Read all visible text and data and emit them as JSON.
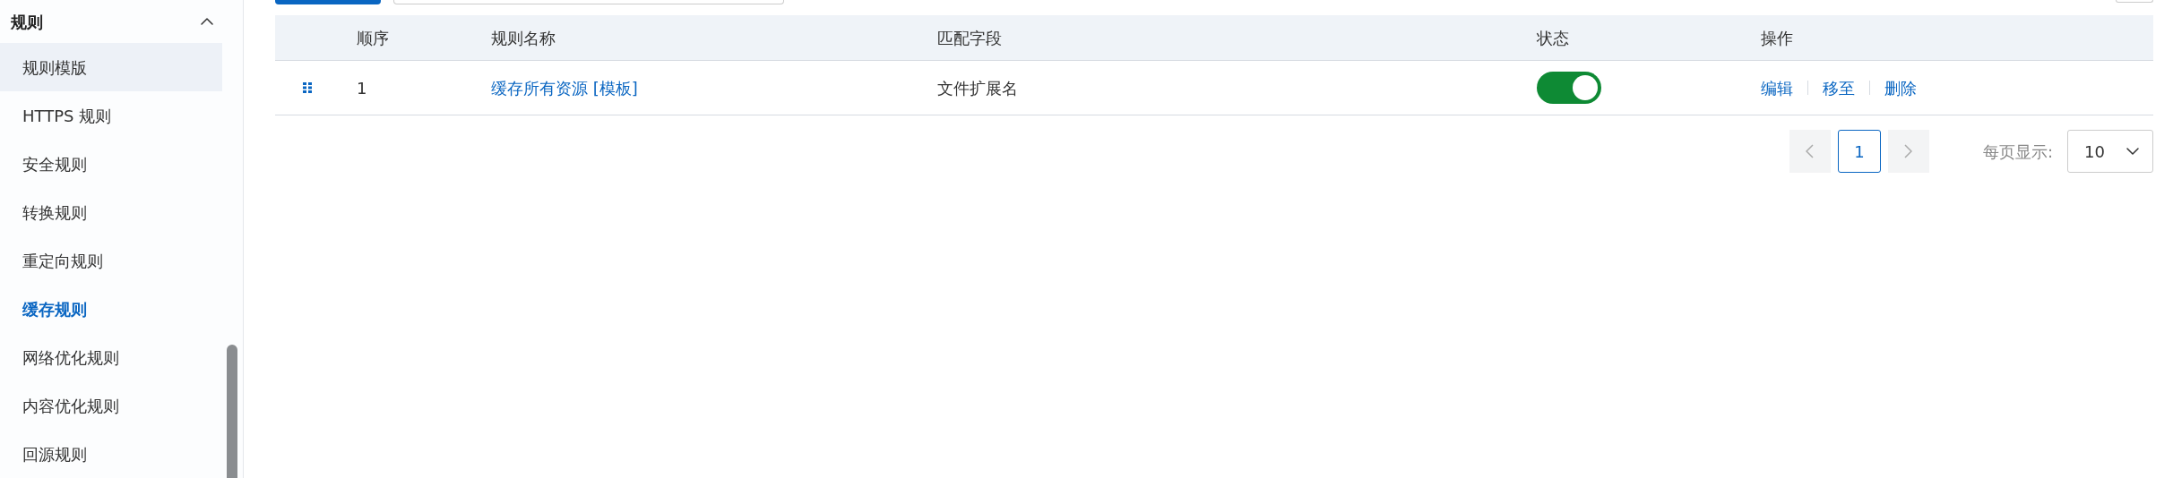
{
  "sidebar": {
    "group": {
      "label": "规则",
      "expanded": true
    },
    "items": [
      {
        "label": "规则模版",
        "selected": false,
        "hovered": true
      },
      {
        "label": "HTTPS 规则",
        "selected": false,
        "hovered": false
      },
      {
        "label": "安全规则",
        "selected": false,
        "hovered": false
      },
      {
        "label": "转换规则",
        "selected": false,
        "hovered": false
      },
      {
        "label": "重定向规则",
        "selected": false,
        "hovered": false
      },
      {
        "label": "缓存规则",
        "selected": true,
        "hovered": false
      },
      {
        "label": "网络优化规则",
        "selected": false,
        "hovered": false
      },
      {
        "label": "内容优化规则",
        "selected": false,
        "hovered": false
      },
      {
        "label": "回源规则",
        "selected": false,
        "hovered": false
      }
    ]
  },
  "table": {
    "columns": [
      "顺序",
      "规则名称",
      "匹配字段",
      "状态",
      "操作"
    ],
    "rows": [
      {
        "order": "1",
        "name": "缓存所有资源 [模板]",
        "match_field": "文件扩展名",
        "on": true,
        "actions": [
          "编辑",
          "移至",
          "删除"
        ]
      }
    ]
  },
  "pagination": {
    "pages": [
      {
        "label": "1",
        "selected": true
      }
    ],
    "page_size_label": "每页显示:",
    "page_size": "10"
  }
}
